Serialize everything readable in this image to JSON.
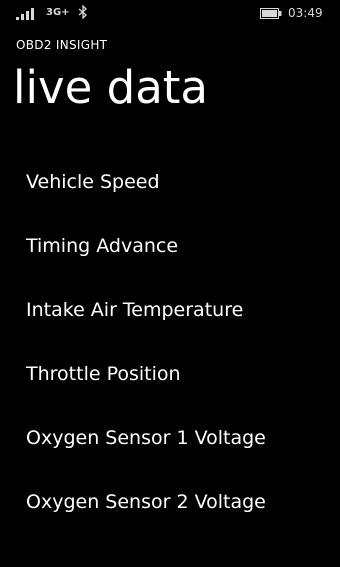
{
  "status_bar": {
    "network": "3G+",
    "time": "03:49",
    "icons": [
      "signal-icon",
      "bluetooth-icon",
      "battery-icon"
    ]
  },
  "app_title": "OBD2 INSIGHT",
  "page_title": "live data",
  "items": [
    {
      "label": "Vehicle Speed"
    },
    {
      "label": "Timing Advance"
    },
    {
      "label": "Intake Air Temperature"
    },
    {
      "label": "Throttle Position"
    },
    {
      "label": "Oxygen Sensor 1 Voltage"
    },
    {
      "label": "Oxygen Sensor 2 Voltage"
    }
  ]
}
